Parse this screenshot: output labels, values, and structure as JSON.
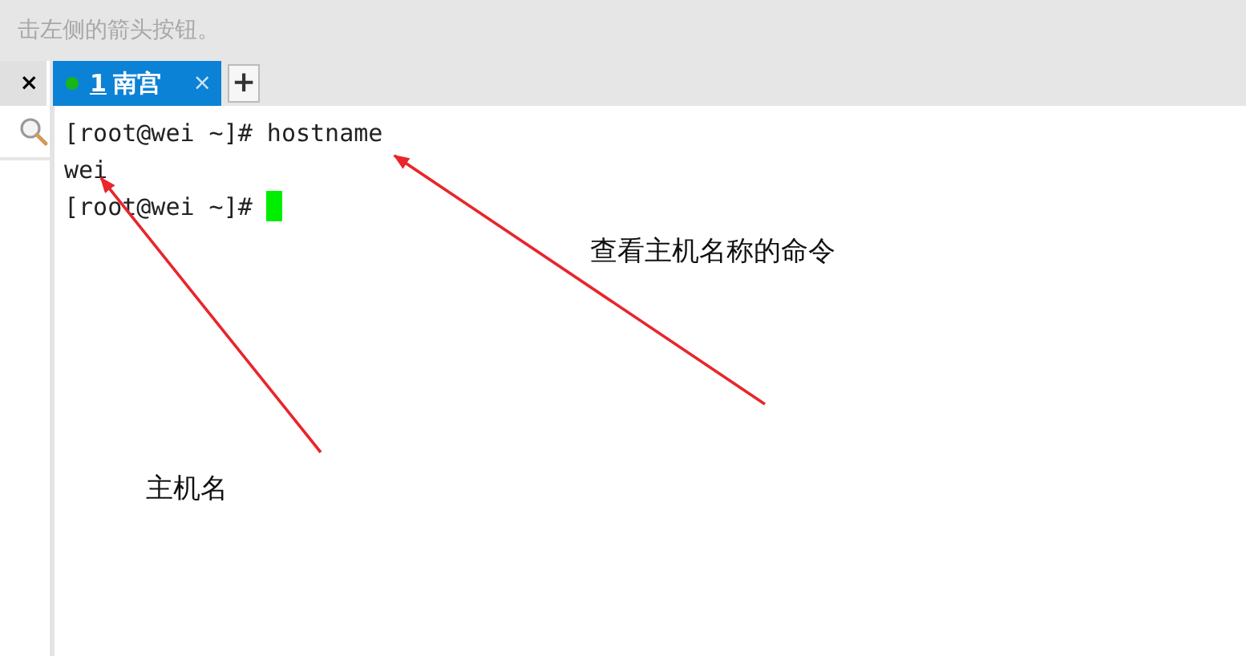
{
  "hint": "击左侧的箭头按钮。",
  "tabs": [
    {
      "selected": false,
      "close": "×"
    },
    {
      "number": "1",
      "label": "南宫",
      "selected": true,
      "connected": true,
      "close": "×"
    }
  ],
  "new_tab": "+",
  "terminal": {
    "lines": [
      "[root@wei ~]# hostname",
      "wei",
      "[root@wei ~]# "
    ],
    "cursor": true
  },
  "annotations": [
    {
      "text": "查看主机名称的命令"
    },
    {
      "text": "主机名"
    }
  ]
}
